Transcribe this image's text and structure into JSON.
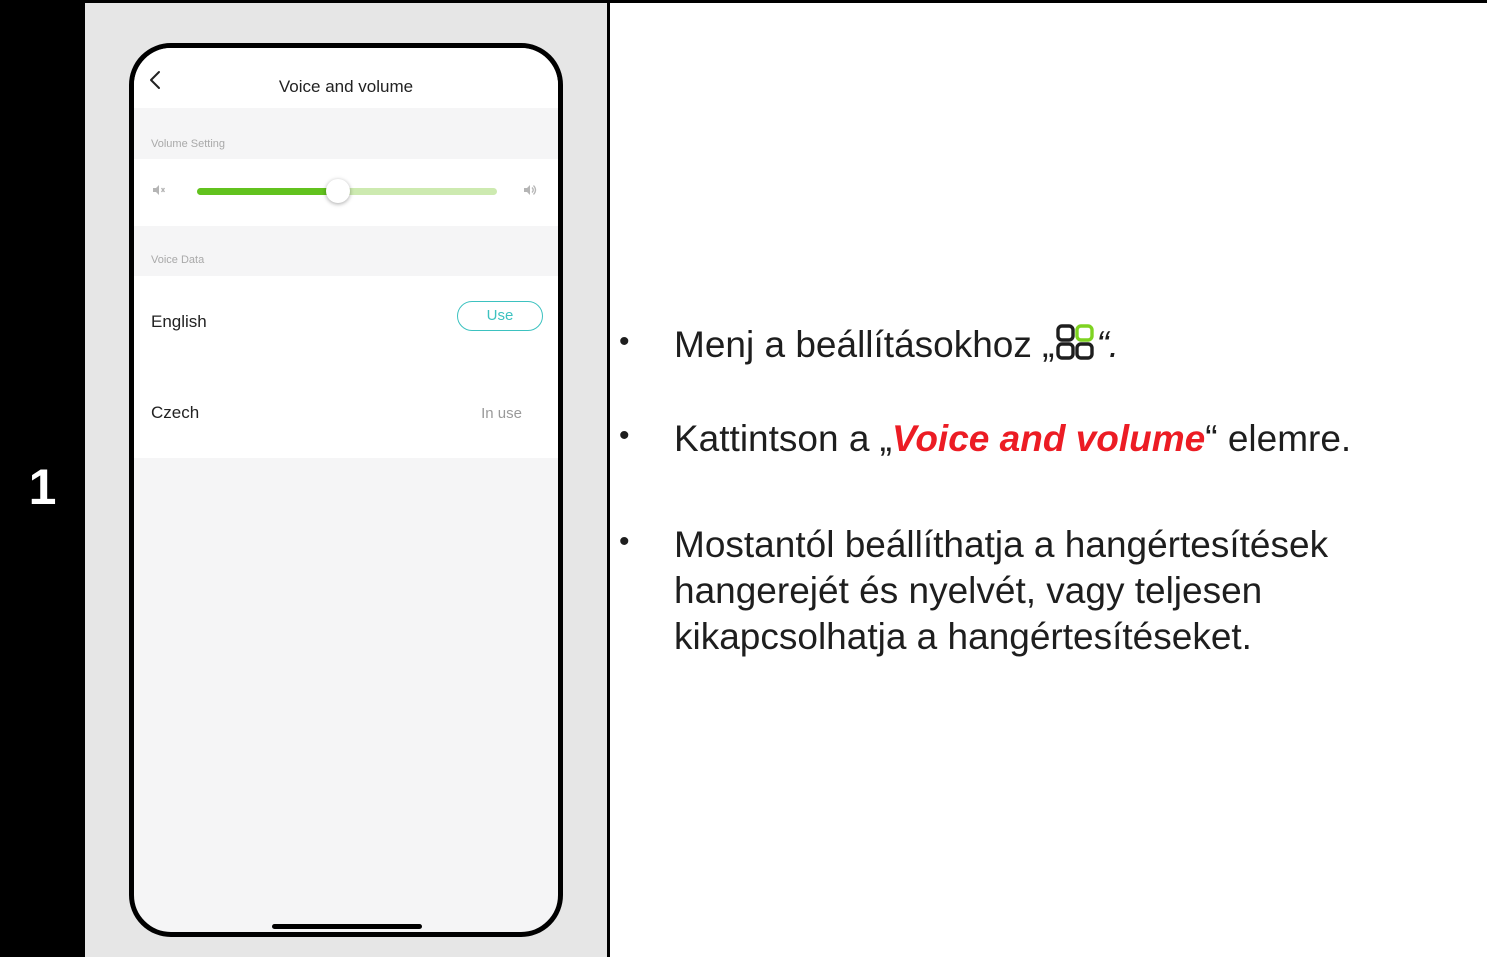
{
  "step": {
    "number": "1"
  },
  "phone": {
    "title": "Voice and volume",
    "volume_section": "Volume Setting",
    "volume_level": 0.47,
    "voice_section": "Voice Data",
    "languages": [
      {
        "name": "English",
        "action": "Use"
      },
      {
        "name": "Czech",
        "status": "In use"
      }
    ]
  },
  "instructions": {
    "b1_before": "Menj a beállításokhoz „",
    "b1_after": "“.",
    "b1_icon": "settings-grid-icon",
    "b2_before": "Kattintson a „",
    "b2_highlight": "Voice and volume",
    "b2_after": "“ elemre.",
    "b3_line1": "Mostantól beállíthatja a hangértesítések",
    "b3_line2": "hangerejét és nyelvét, vagy teljesen",
    "b3_line3": "kikapcsolhatja a hangértesítéseket."
  },
  "colors": {
    "highlight": "#ec1c24",
    "slider_fill": "#62c21e",
    "slider_track": "#cdeab0",
    "button_accent": "#3dc2c0",
    "icon_green": "#7ed321"
  }
}
